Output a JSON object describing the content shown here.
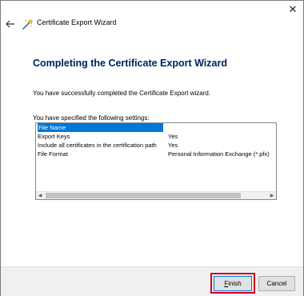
{
  "window": {
    "title": "Certificate Export Wizard",
    "close_glyph": "✕"
  },
  "content": {
    "heading": "Completing the Certificate Export Wizard",
    "success_text": "You have successfully completed the Certificate Export wizard.",
    "settings_label": "You have specified the following settings:"
  },
  "settings": {
    "rows": [
      {
        "key": "File Name",
        "value": ""
      },
      {
        "key": "Export Keys",
        "value": "Yes"
      },
      {
        "key": "Include all certificates in the certification path",
        "value": "Yes"
      },
      {
        "key": "File Format",
        "value": "Personal Information Exchange (*.pfx)"
      }
    ],
    "selected_index": 0
  },
  "buttons": {
    "finish_first": "F",
    "finish_rest": "inish",
    "cancel": "Cancel"
  },
  "colors": {
    "heading": "#002060",
    "selection": "#0078d7",
    "highlight": "#d0021b"
  },
  "icons": {
    "back": "back-arrow-icon",
    "wizard": "certificate-wizard-icon",
    "close": "close-icon"
  }
}
